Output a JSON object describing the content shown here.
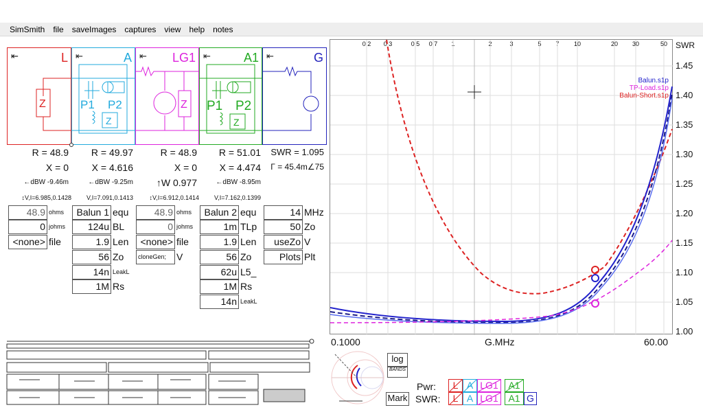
{
  "menu": [
    "SimSmith",
    "file",
    "saveImages",
    "captures",
    "view",
    "help",
    "notes"
  ],
  "blocks": [
    {
      "label": "L",
      "color": "#dd2222",
      "R": "R = 48.9",
      "X": "X = 0",
      "pw": "←dBW -9.46m",
      "vi": "↕V,I=6.985,0.1428"
    },
    {
      "label": "A",
      "color": "#22aadd",
      "R": "R = 49.97",
      "X": "X = 4.616",
      "pw": "←dBW -9.25m",
      "vi": "V,I=7.091,0.1413"
    },
    {
      "label": "LG1",
      "color": "#dd22dd",
      "R": "R = 48.9",
      "X": "X = 0",
      "pw": "↑W 0.977",
      "vi": "↕V,I=6.912,0.1414"
    },
    {
      "label": "A1",
      "color": "#22aa22",
      "R": "R = 51.01",
      "X": "X = 4.474",
      "pw": "←dBW -8.95m",
      "vi": "V,I=7.162,0.1399"
    },
    {
      "label": "G",
      "color": "#2222bb",
      "R": "SWR = 1.095",
      "X": "Γ = 45.4m∠75",
      "pw": "",
      "vi": ""
    }
  ],
  "params": {
    "L": [
      {
        "value": "48.9",
        "unit": "ohms"
      },
      {
        "value": "0",
        "unit": "johms"
      },
      {
        "value": "<none>",
        "unit": "file"
      }
    ],
    "A": [
      {
        "value": "Balun 1",
        "unit": "equ"
      },
      {
        "value": "124u",
        "unit": "BL"
      },
      {
        "value": "1.9",
        "unit": "Len"
      },
      {
        "value": "56",
        "unit": "Zo"
      },
      {
        "value": "14n",
        "unit": "LeakL"
      },
      {
        "value": "1M",
        "unit": "Rs"
      }
    ],
    "LG1": [
      {
        "value": "48.9",
        "unit": "ohms"
      },
      {
        "value": "0",
        "unit": "johms"
      },
      {
        "value": "<none>",
        "unit": "file"
      },
      {
        "value": "cloneGen;",
        "unit": "V"
      }
    ],
    "A1": [
      {
        "value": "Balun 2",
        "unit": "equ"
      },
      {
        "value": "1m",
        "unit": "TLp"
      },
      {
        "value": "1.9",
        "unit": "Len"
      },
      {
        "value": "56",
        "unit": "Zo"
      },
      {
        "value": "62u",
        "unit": "L5_"
      },
      {
        "value": "1M",
        "unit": "Rs"
      },
      {
        "value": "14n",
        "unit": "LeakL"
      }
    ],
    "G": [
      {
        "value": "14",
        "unit": "MHz"
      },
      {
        "value": "50",
        "unit": "Zo"
      },
      {
        "value": "useZo",
        "unit": "V"
      },
      {
        "value": "Plots",
        "unit": "Plt"
      }
    ]
  },
  "chart": {
    "swr_header": "SWR",
    "swr_ticks": [
      "1.45",
      "1.40",
      "1.35",
      "1.30",
      "1.25",
      "1.20",
      "1.15",
      "1.10",
      "1.05",
      "1.00"
    ],
    "top_ticks": [
      "0.2",
      "0.3",
      "0.5",
      "0.7",
      "1",
      "2",
      "3",
      "5",
      "7",
      "10",
      "20",
      "30",
      "50"
    ],
    "x_start": "0.1000",
    "x_label": "G.MHz",
    "x_end": "60.00",
    "legend": [
      {
        "name": "Balun.s1p",
        "color": "#2222cc"
      },
      {
        "name": "TP-Load.s1p",
        "color": "#dd22dd"
      },
      {
        "name": "Balun-Short.s1p",
        "color": "#dd2222"
      }
    ]
  },
  "controls": {
    "log_label": "log",
    "bands_label": "BANDS",
    "mark_label": "Mark",
    "pwr_label": "Pwr:",
    "swr_label": "SWR:",
    "pwr_toggles": [
      {
        "t": "L",
        "c": "#dd2222"
      },
      {
        "t": "A",
        "c": "#22aadd"
      },
      {
        "t": "LG1",
        "c": "#dd22dd"
      },
      {
        "t": "A1",
        "c": "#22aa22"
      }
    ],
    "swr_toggles": [
      {
        "t": "L",
        "c": "#dd2222"
      },
      {
        "t": "A",
        "c": "#22aadd"
      },
      {
        "t": "LG1",
        "c": "#dd22dd"
      },
      {
        "t": "A1",
        "c": "#22aa22"
      },
      {
        "t": "G",
        "c": "#2222bb"
      }
    ]
  }
}
